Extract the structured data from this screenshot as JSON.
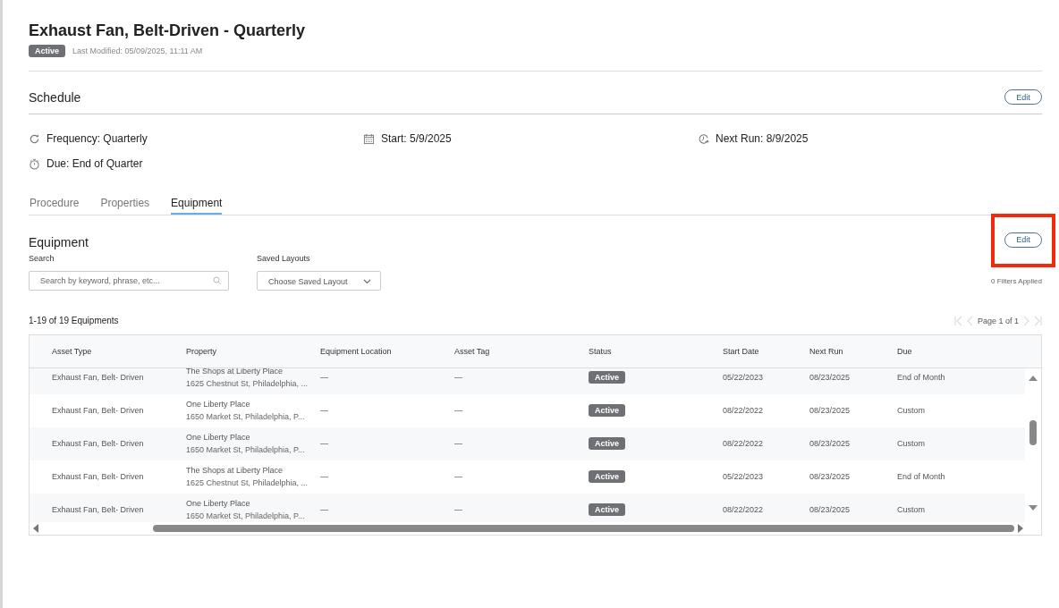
{
  "header": {
    "title": "Exhaust Fan, Belt-Driven - Quarterly",
    "status": "Active",
    "last_modified": "Last Modified: 05/09/2025, 11:11 AM"
  },
  "schedule": {
    "title": "Schedule",
    "edit_button": "Edit",
    "items": [
      {
        "kind": "frequency",
        "text": "Frequency: Quarterly"
      },
      {
        "kind": "start",
        "text": "Start: 5/9/2025"
      },
      {
        "kind": "next_run",
        "text": "Next Run: 8/9/2025"
      },
      {
        "kind": "due",
        "text": "Due: End of Quarter"
      }
    ]
  },
  "tabs": [
    {
      "label": "Procedure",
      "selected": false
    },
    {
      "label": "Properties",
      "selected": false
    },
    {
      "label": "Equipment",
      "selected": true
    }
  ],
  "equipment": {
    "title": "Equipment",
    "edit_button": {
      "label": "Edit",
      "highlighted": true
    },
    "search": {
      "label": "Search",
      "placeholder": "Search by keyword, phrase, etc..."
    },
    "saved_layouts": {
      "label": "Saved Layouts",
      "placeholder": "Choose Saved Layout"
    },
    "filters": "0 Filters Applied",
    "count": "1-19 of 19 Equipments",
    "pagination": "Page 1 of 1",
    "table": {
      "columns": [
        "Asset Type",
        "Property",
        "Equipment Location",
        "Asset Tag",
        "Status",
        "Start Date",
        "Next Run",
        "Due"
      ],
      "rows": [
        {
          "asset_type": "Exhaust Fan, Belt- Driven",
          "property_name": "The Shops at Liberty Place",
          "property_address": "1625 Chestnut St, Philadelphia, ...",
          "location": "—",
          "asset_tag": "—",
          "status": "Active",
          "start_date": "05/22/2023",
          "next_run": "08/23/2025",
          "due": "End of Month"
        },
        {
          "asset_type": "Exhaust Fan, Belt- Driven",
          "property_name": "One Liberty Place",
          "property_address": "1650 Market St, Philadelphia, P...",
          "location": "—",
          "asset_tag": "—",
          "status": "Active",
          "start_date": "08/22/2022",
          "next_run": "08/23/2025",
          "due": "Custom"
        },
        {
          "asset_type": "Exhaust Fan, Belt- Driven",
          "property_name": "One Liberty Place",
          "property_address": "1650 Market St, Philadelphia, P...",
          "location": "—",
          "asset_tag": "—",
          "status": "Active",
          "start_date": "08/22/2022",
          "next_run": "08/23/2025",
          "due": "Custom"
        },
        {
          "asset_type": "Exhaust Fan, Belt- Driven",
          "property_name": "The Shops at Liberty Place",
          "property_address": "1625 Chestnut St, Philadelphia, ...",
          "location": "—",
          "asset_tag": "—",
          "status": "Active",
          "start_date": "05/22/2023",
          "next_run": "08/23/2025",
          "due": "End of Month"
        },
        {
          "asset_type": "Exhaust Fan, Belt- Driven",
          "property_name": "One Liberty Place",
          "property_address": "1650 Market St, Philadelphia, P...",
          "location": "—",
          "asset_tag": "—",
          "status": "Active",
          "start_date": "08/22/2022",
          "next_run": "08/23/2025",
          "due": "Custom"
        }
      ]
    }
  }
}
